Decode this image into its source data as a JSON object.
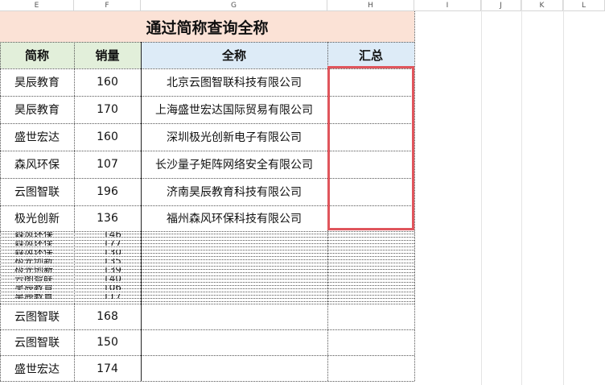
{
  "columns": [
    "E",
    "F",
    "G",
    "H",
    "I",
    "J",
    "K",
    "L"
  ],
  "title": "通过简称查询全称",
  "headers": {
    "abbr": "简称",
    "sales": "销量",
    "fullname": "全称",
    "summary": "汇总"
  },
  "lookup_rows": [
    {
      "abbr": "昊辰教育",
      "sales": "160",
      "fullname": "北京云图智联科技有限公司",
      "summary": ""
    },
    {
      "abbr": "昊辰教育",
      "sales": "170",
      "fullname": "上海盛世宏达国际贸易有限公司",
      "summary": ""
    },
    {
      "abbr": "盛世宏达",
      "sales": "160",
      "fullname": "深圳极光创新电子有限公司",
      "summary": ""
    },
    {
      "abbr": "森风环保",
      "sales": "107",
      "fullname": "长沙量子矩阵网络安全有限公司",
      "summary": ""
    },
    {
      "abbr": "云图智联",
      "sales": "196",
      "fullname": "济南昊辰教育科技有限公司",
      "summary": ""
    },
    {
      "abbr": "极光创新",
      "sales": "136",
      "fullname": "福州森风环保科技有限公司",
      "summary": ""
    }
  ],
  "compressed_rows": [
    {
      "abbr": "森风环保",
      "sales": "146"
    },
    {
      "abbr": "森风环保",
      "sales": "177"
    },
    {
      "abbr": "森风环保",
      "sales": "130"
    },
    {
      "abbr": "极光创新",
      "sales": "135"
    },
    {
      "abbr": "极光创新",
      "sales": "139"
    },
    {
      "abbr": "云图智联",
      "sales": "140"
    },
    {
      "abbr": "昊辰教育",
      "sales": "106"
    },
    {
      "abbr": "昊辰教育",
      "sales": "117"
    }
  ],
  "bottom_rows": [
    {
      "abbr": "云图智联",
      "sales": "168"
    },
    {
      "abbr": "云图智联",
      "sales": "150"
    },
    {
      "abbr": "盛世宏达",
      "sales": "174"
    }
  ],
  "highlight_color": "#e0555c",
  "title_fill": "#fbe2d6",
  "header_green": "#e2efda",
  "header_blue": "#ddebf7"
}
